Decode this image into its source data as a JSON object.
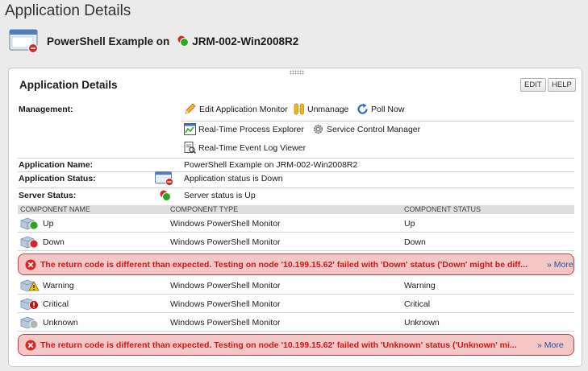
{
  "page": {
    "title": "Application Details"
  },
  "header": {
    "app_name": "PowerShell Example on",
    "node_name": "JRM-002-Win2008R2"
  },
  "panel": {
    "title": "Application Details",
    "edit_label": "EDIT",
    "help_label": "HELP",
    "management_label": "Management:",
    "actions": {
      "edit_monitor": "Edit Application Monitor",
      "unmanage": "Unmanage",
      "poll_now": "Poll Now",
      "process_explorer": "Real-Time Process Explorer",
      "service_manager": "Service Control Manager",
      "event_log": "Real-Time Event Log Viewer"
    },
    "details": {
      "app_name_label": "Application Name:",
      "app_name_value": "PowerShell Example on JRM-002-Win2008R2",
      "app_status_label": "Application Status:",
      "app_status_value": "Application status is Down",
      "server_status_label": "Server Status:",
      "server_status_value": "Server status is Up"
    },
    "table": {
      "columns": [
        "COMPONENT NAME",
        "COMPONENT TYPE",
        "COMPONENT STATUS"
      ],
      "rows": [
        {
          "name": "Up",
          "type": "Windows PowerShell Monitor",
          "status": "Up",
          "state": "up"
        },
        {
          "name": "Down",
          "type": "Windows PowerShell Monitor",
          "status": "Down",
          "state": "down"
        },
        {
          "name": "Warning",
          "type": "Windows PowerShell Monitor",
          "status": "Warning",
          "state": "warning"
        },
        {
          "name": "Critical",
          "type": "Windows PowerShell Monitor",
          "status": "Critical",
          "state": "critical"
        },
        {
          "name": "Unknown",
          "type": "Windows PowerShell Monitor",
          "status": "Unknown",
          "state": "unknown"
        }
      ],
      "errors": [
        {
          "message": "The return code is different than expected. Testing on node '10.199.15.62' failed with 'Down' status ('Down' might be diff...",
          "more": "» More"
        },
        {
          "message": "The return code is different than expected. Testing on node '10.199.15.62' failed with 'Unknown' status ('Unknown' mi...",
          "more": "» More"
        }
      ]
    }
  },
  "colors": {
    "up": "#27a81e",
    "down": "#d62828",
    "warning": "#f2c100",
    "critical": "#c31414",
    "unknown": "#b5b5b5",
    "error_bg": "#f4c7c7",
    "error_text": "#d01818",
    "link": "#2a52a8"
  }
}
